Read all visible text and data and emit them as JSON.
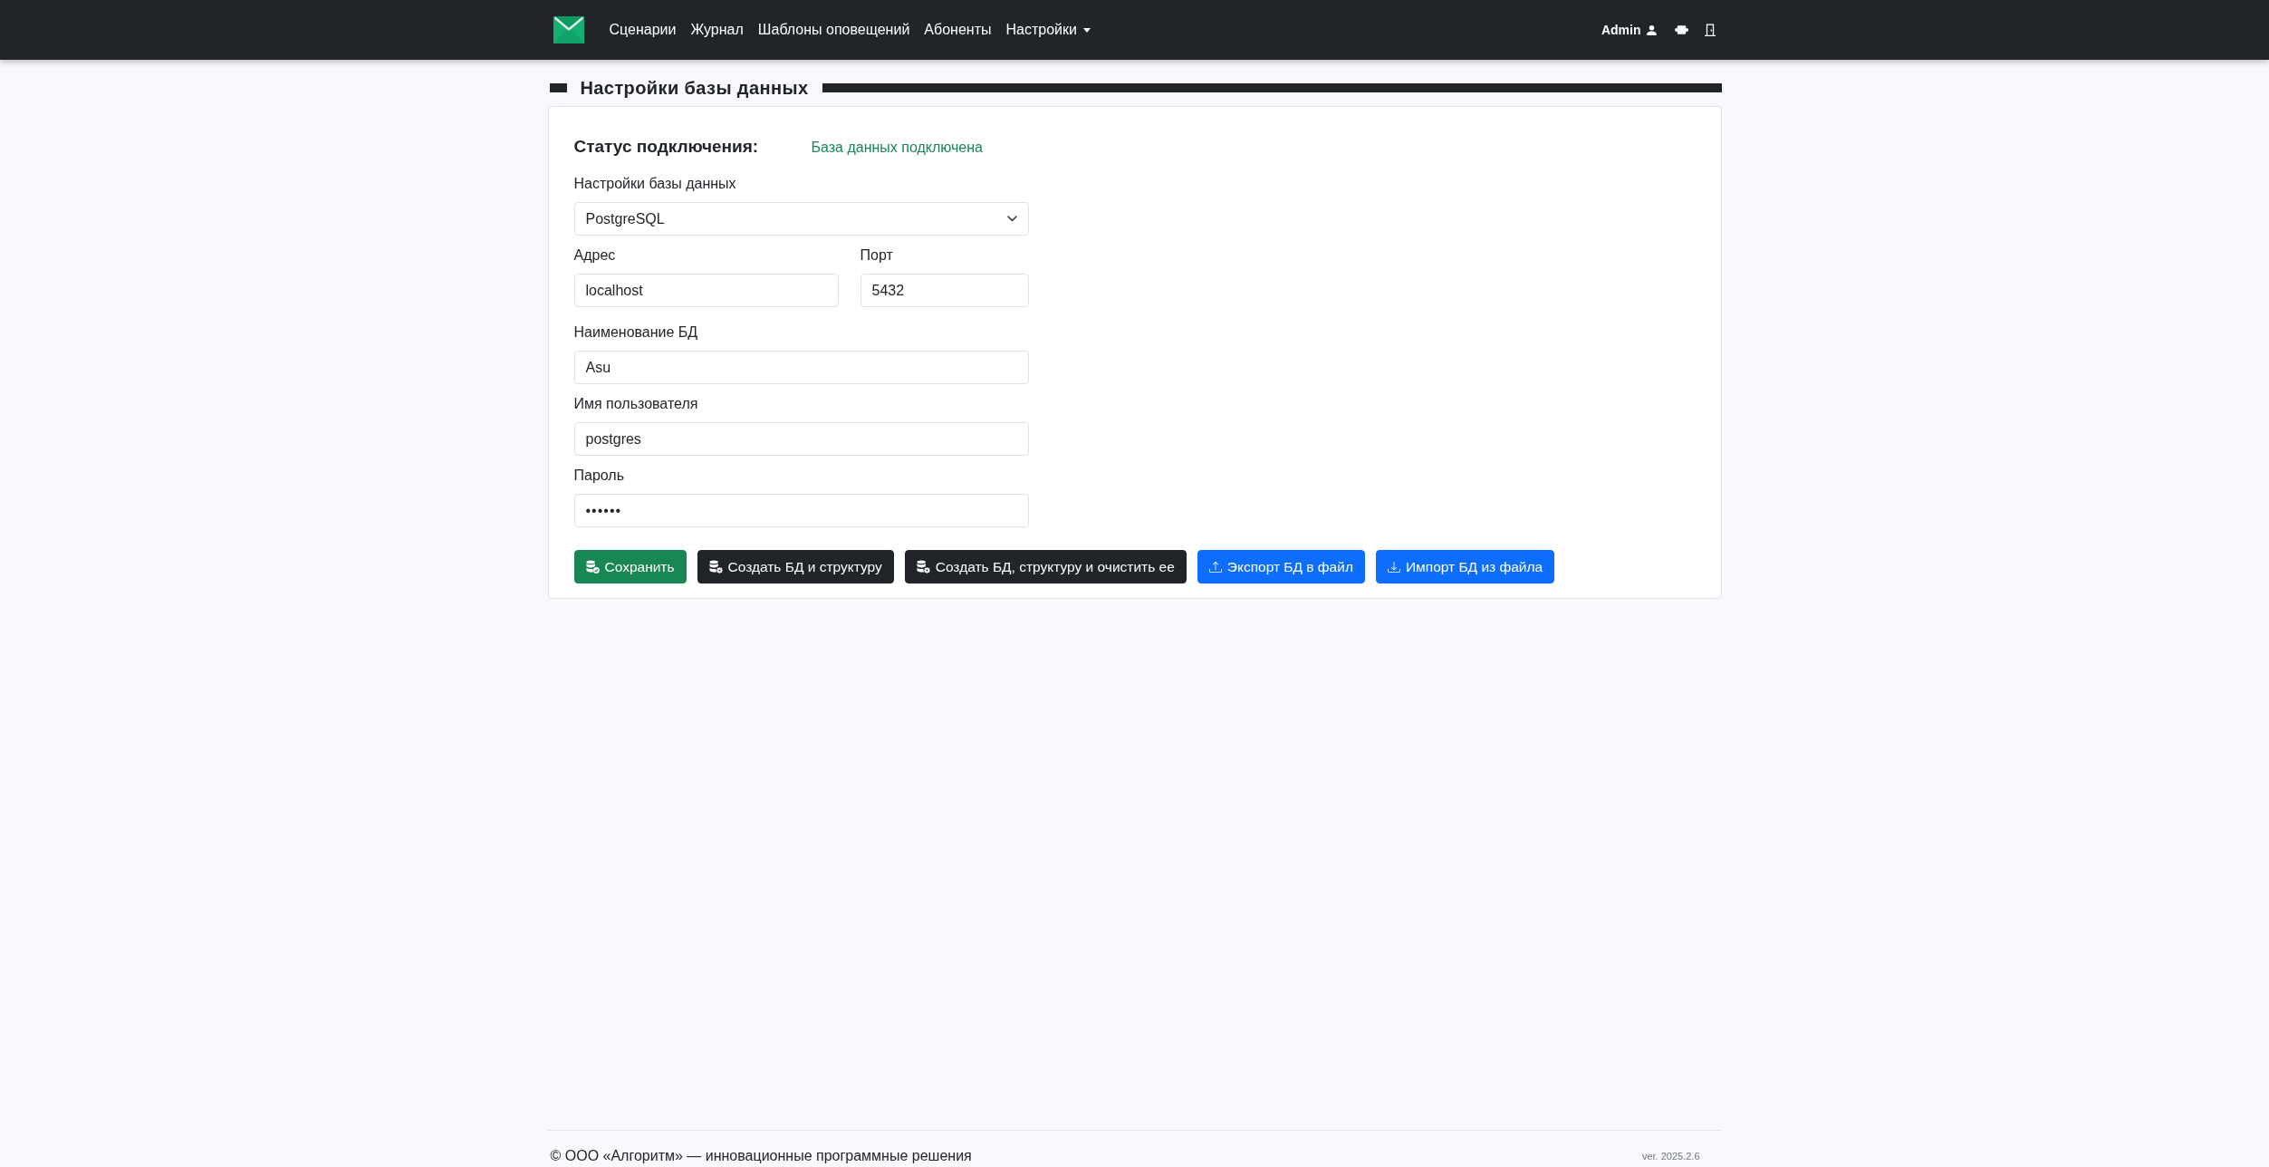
{
  "navbar": {
    "links": [
      {
        "label": "Сценарии",
        "kind": "link"
      },
      {
        "label": "Журнал",
        "kind": "link"
      },
      {
        "label": "Шаблоны оповещений",
        "kind": "link"
      },
      {
        "label": "Абоненты",
        "kind": "link"
      },
      {
        "label": "Настройки",
        "kind": "dropdown"
      }
    ],
    "user": {
      "name": "Admin"
    }
  },
  "section": {
    "title": "Настройки базы данных"
  },
  "status": {
    "label": "Статус подключения:",
    "value": "База данных подключена",
    "connected": true
  },
  "form": {
    "rows": [
      [
        {
          "kind": "select",
          "label": "Настройки базы данных",
          "value": "PostgreSQL"
        }
      ],
      [
        {
          "kind": "text",
          "label": "Адрес",
          "value": "localhost"
        },
        {
          "kind": "text",
          "label": "Порт",
          "value": "5432"
        }
      ],
      [
        {
          "kind": "text",
          "label": "Наименование БД",
          "value": "Asu"
        }
      ],
      [
        {
          "kind": "text",
          "label": "Имя пользователя",
          "value": "postgres"
        }
      ],
      [
        {
          "kind": "password",
          "label": "Пароль",
          "value": "••••••"
        }
      ]
    ]
  },
  "buttons": [
    {
      "kind": "save",
      "label": "Сохранить"
    },
    {
      "kind": "create",
      "label": "Создать БД и структуру"
    },
    {
      "kind": "recreate",
      "label": "Создать БД, структуру и очистить ее"
    },
    {
      "kind": "export",
      "label": "Экспорт БД в файл"
    },
    {
      "kind": "import",
      "label": "Импорт БД из файла"
    }
  ],
  "footer": {
    "copyright": "© ООО «Алгоритм» — инновационные программные решения",
    "version": "ver. 2025.2.6"
  }
}
